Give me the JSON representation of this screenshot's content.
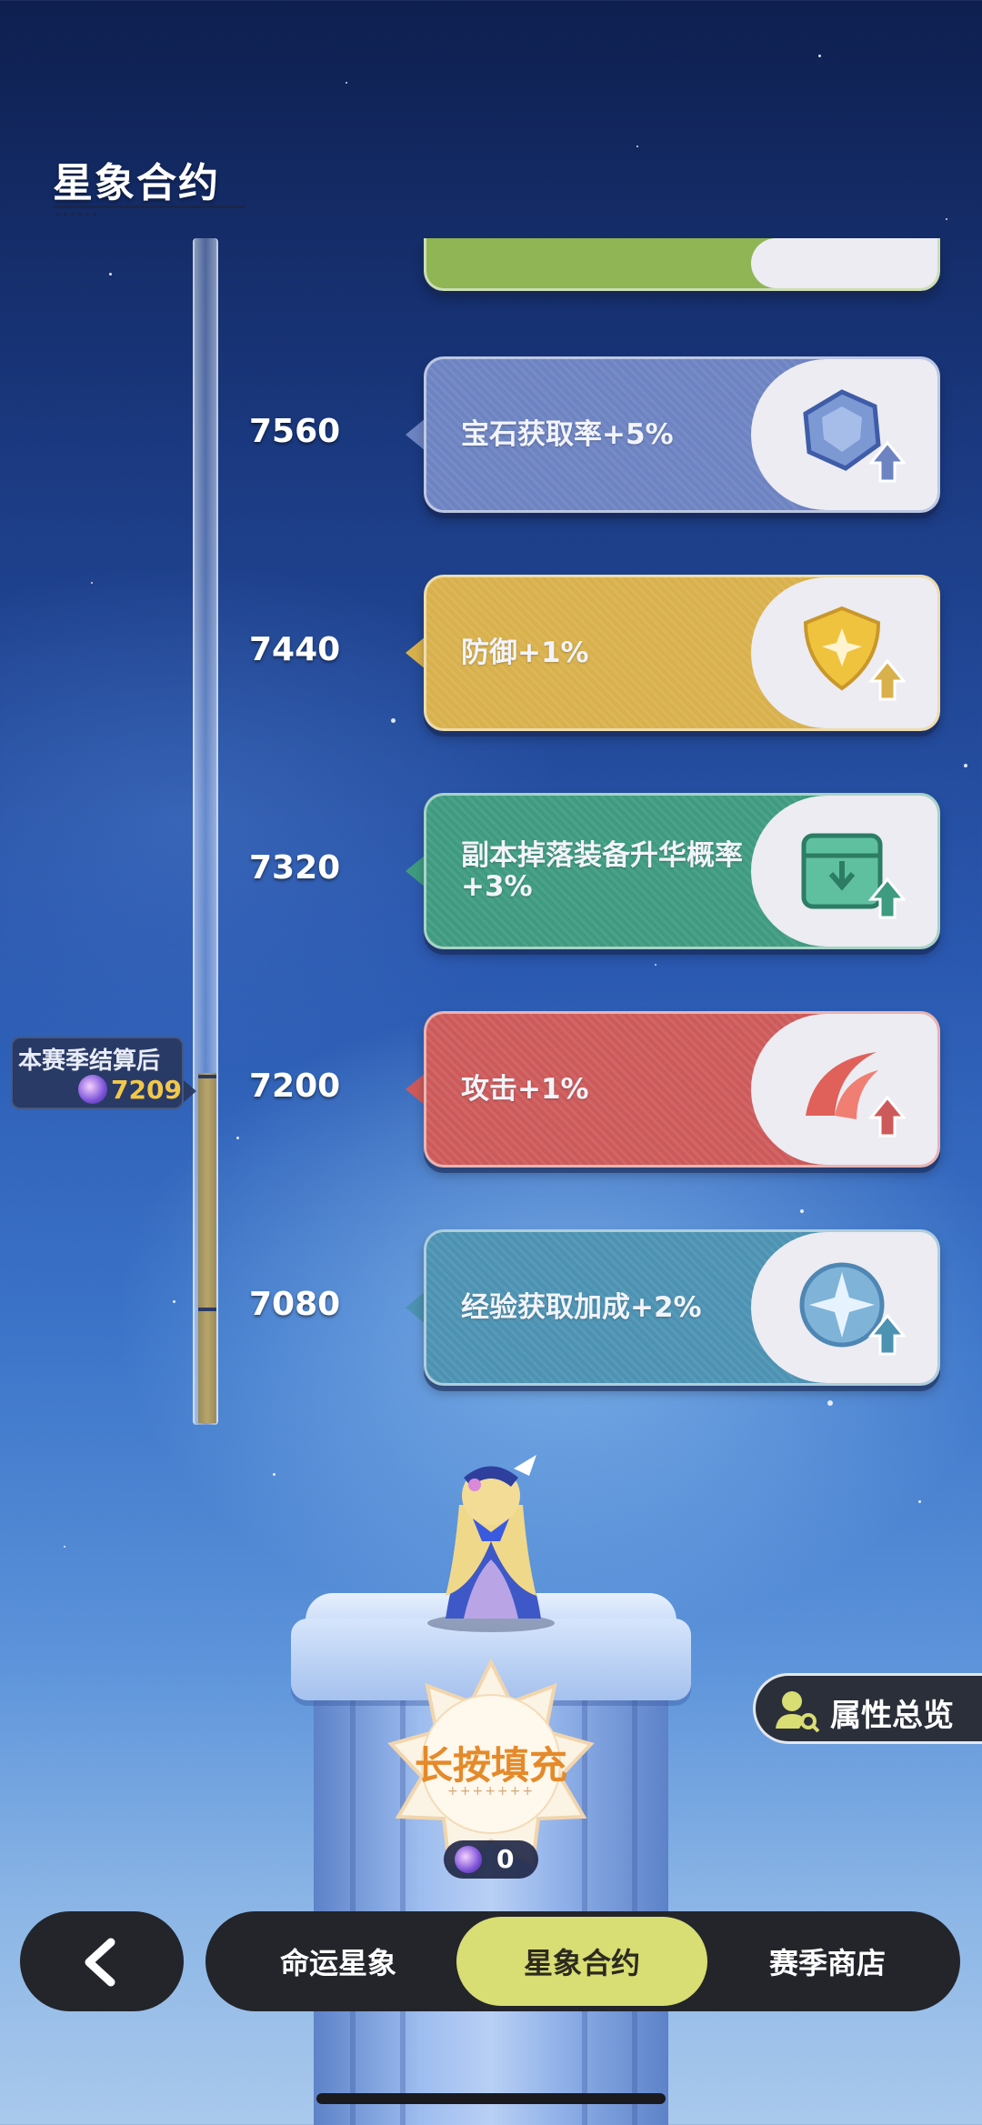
{
  "header": {
    "title": "星象合约"
  },
  "track": {
    "settle_title": "本赛季结算后",
    "settle_value": "7209",
    "progress_fraction": 0.28
  },
  "rewards": [
    {
      "level": "7560",
      "label": "宝石获取率+5%",
      "color": "#6d83c2",
      "icon": "gem-upgrade-icon"
    },
    {
      "level": "7440",
      "label": "防御+1%",
      "color": "#d9b14c",
      "icon": "shield-upgrade-icon"
    },
    {
      "level": "7320",
      "label": "副本掉落装备升华概率+3%",
      "color": "#3f9b80",
      "icon": "box-upgrade-icon"
    },
    {
      "level": "7200",
      "label": "攻击+1%",
      "color": "#cd5a5a",
      "icon": "slash-upgrade-icon"
    },
    {
      "level": "7080",
      "label": "经验获取加成+2%",
      "color": "#4c92b2",
      "icon": "star-compass-upgrade-icon"
    }
  ],
  "top_card": {
    "color": "#8fb554",
    "icon": "leaf-upgrade-icon"
  },
  "fill": {
    "label": "长按填充",
    "dots": "+++++++",
    "cost": "0"
  },
  "attr_button": {
    "label": "属性总览"
  },
  "nav": {
    "tabs": [
      {
        "label": "命运星象",
        "active": false
      },
      {
        "label": "星象合约",
        "active": true
      },
      {
        "label": "赛季商店",
        "active": false
      }
    ]
  }
}
